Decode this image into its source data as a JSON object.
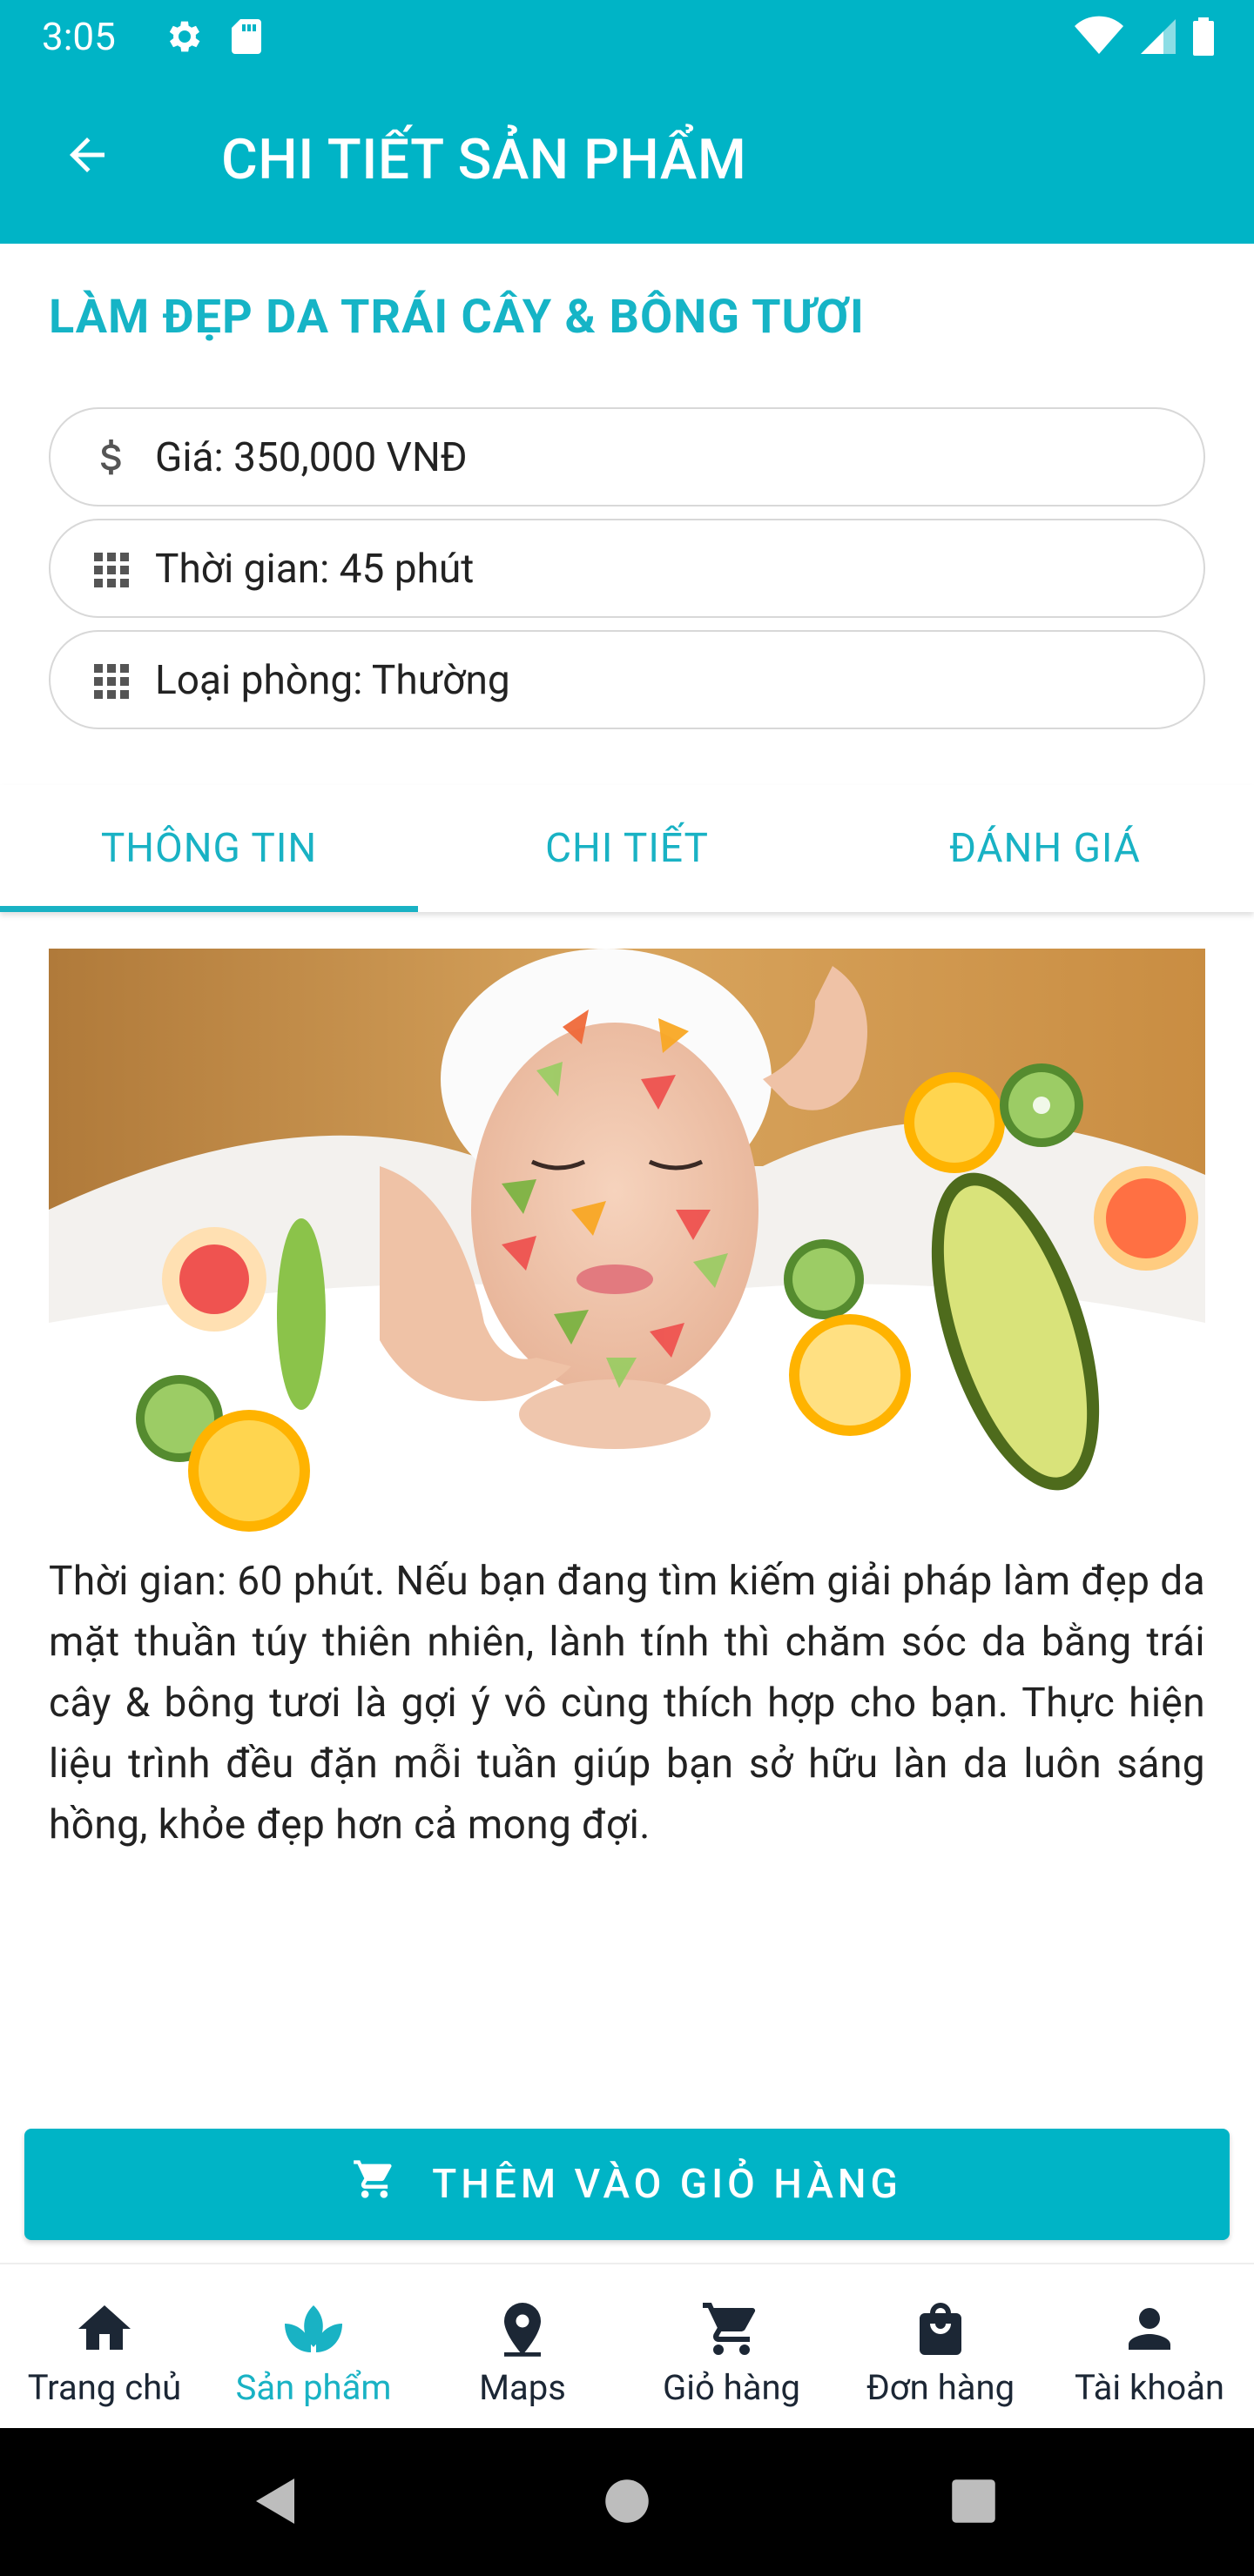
{
  "status_bar": {
    "time": "3:05"
  },
  "app_bar": {
    "title": "CHI TIẾT SẢN PHẨM"
  },
  "product": {
    "title": "LÀM ĐẸP DA TRÁI CÂY & BÔNG TƯƠI",
    "info": [
      {
        "icon": "dollar-icon",
        "text": "Giá: 350,000 VNĐ"
      },
      {
        "icon": "grid-icon",
        "text": "Thời gian: 45 phút"
      },
      {
        "icon": "grid-icon",
        "text": "Loại phòng: Thường"
      }
    ],
    "description": "Thời gian: 60 phút. Nếu bạn đang tìm kiếm giải pháp làm đẹp da mặt thuần túy thiên nhiên, lành tính thì chăm sóc da bằng trái cây & bông tươi là gợi ý vô cùng thích hợp cho bạn. Thực hiện liệu trình đều đặn mỗi tuần giúp bạn sở hữu làn da luôn sáng hồng, khỏe đẹp hơn cả mong đợi."
  },
  "tabs": [
    {
      "label": "THÔNG TIN",
      "active": true
    },
    {
      "label": "CHI TIẾT",
      "active": false
    },
    {
      "label": "ĐÁNH GIÁ",
      "active": false
    }
  ],
  "actions": {
    "add_to_cart_label": "THÊM VÀO GIỎ HÀNG"
  },
  "bottom_nav": [
    {
      "label": "Trang chủ",
      "icon": "home-icon"
    },
    {
      "label": "Sản phẩm",
      "icon": "lotus-icon",
      "active": true
    },
    {
      "label": "Maps",
      "icon": "map-pin-icon"
    },
    {
      "label": "Giỏ hàng",
      "icon": "cart-icon"
    },
    {
      "label": "Đơn hàng",
      "icon": "shopping-bag-icon"
    },
    {
      "label": "Tài khoản",
      "icon": "person-icon"
    }
  ],
  "colors": {
    "primary": "#00b4c6",
    "accent_text": "#19b2c4",
    "nav_text": "#1c2735"
  }
}
